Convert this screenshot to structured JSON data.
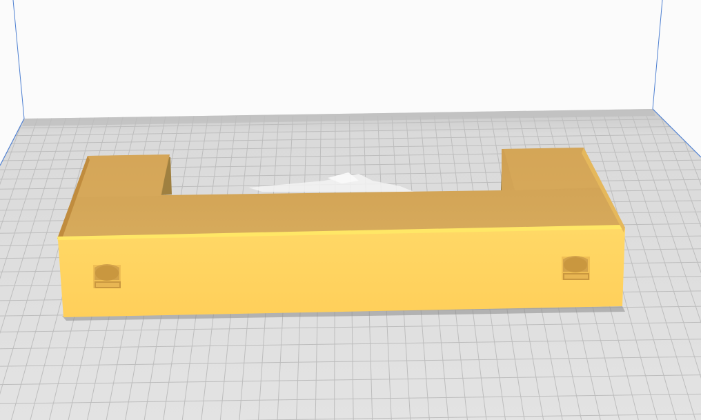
{
  "app": {
    "view": "3d-viewport"
  },
  "scene": {
    "background_color": "#fbfbfb",
    "build_plate_color": "#dcdcdc",
    "grid_line_color": "#b9b9b9",
    "build_volume_edge_color": "#4d7fd1",
    "back_wall_edge_color": "#6f6f6f"
  },
  "model": {
    "name": "",
    "shape": "u-shaped-bracket",
    "color_front": "#ffd15a",
    "color_top": "#d3a556",
    "color_inner": "#c99545",
    "color_top_edge": "#ffee66",
    "holes": 2
  }
}
